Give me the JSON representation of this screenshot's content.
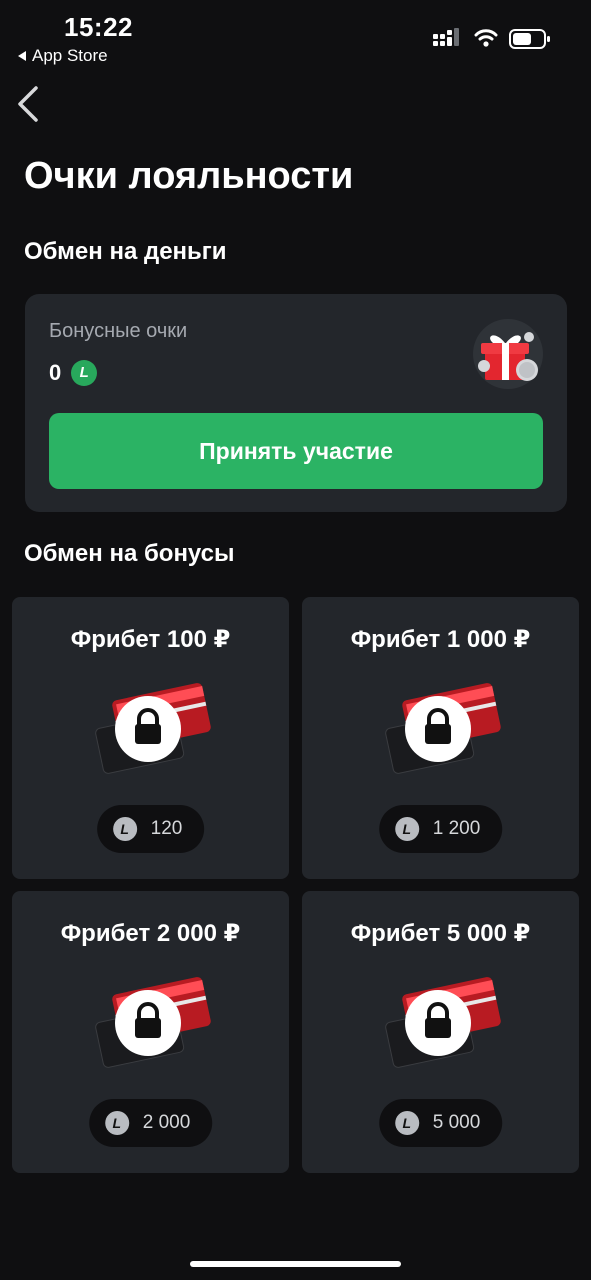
{
  "status_bar": {
    "time": "15:22",
    "back_app": "App Store"
  },
  "header": {
    "title": "Очки лояльности"
  },
  "money_section": {
    "title": "Обмен на деньги",
    "label": "Бонусные очки",
    "value": "0",
    "coin_letter": "L",
    "button_label": "Принять участие"
  },
  "bonus_section": {
    "title": "Обмен на бонусы",
    "items": [
      {
        "title": "Фрибет 100 ₽",
        "cost": "120"
      },
      {
        "title": "Фрибет 1 000 ₽",
        "cost": "1 200"
      },
      {
        "title": "Фрибет 2 000 ₽",
        "cost": "2 000"
      },
      {
        "title": "Фрибет 5 000 ₽",
        "cost": "5 000"
      }
    ],
    "coin_letter": "L"
  },
  "colors": {
    "background": "#0f0f11",
    "card": "#23262b",
    "accent_green": "#2bb364",
    "ticket_red": "#e3262f"
  },
  "icons": [
    "signal-icon",
    "wifi-icon",
    "battery-icon",
    "back-chevron-icon",
    "gift-icon",
    "lock-icon",
    "coin-icon"
  ]
}
